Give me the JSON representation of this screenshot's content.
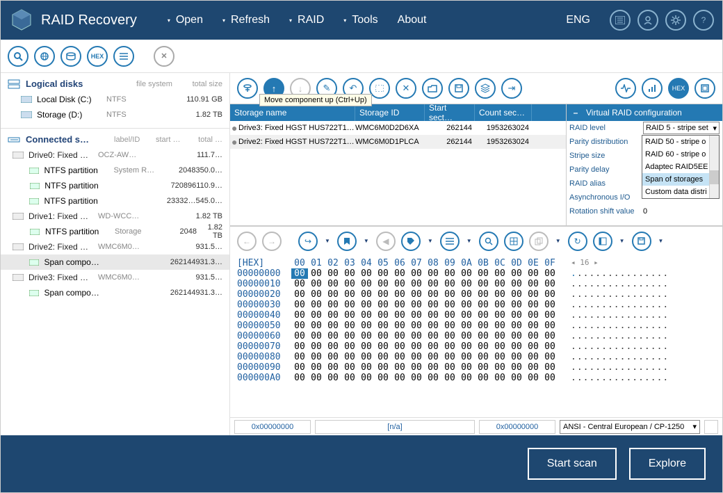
{
  "app": {
    "title": "RAID Recovery"
  },
  "menu": {
    "open": "Open",
    "refresh": "Refresh",
    "raid": "RAID",
    "tools": "Tools",
    "about": "About",
    "lang": "ENG"
  },
  "sidebar": {
    "logical_head": "Logical disks",
    "col_fs": "file system",
    "col_total": "total size",
    "logical": [
      {
        "name": "Local Disk (C:)",
        "fs": "NTFS",
        "size": "110.91 GB"
      },
      {
        "name": "Storage (D:)",
        "fs": "NTFS",
        "size": "1.82 TB"
      }
    ],
    "connected_head": "Connected s…",
    "col_label": "label/ID",
    "col_start": "start …",
    "col_total2": "total …",
    "drives": [
      {
        "name": "Drive0: Fixed …",
        "label": "OCZ-AW…",
        "start": "",
        "size": "111.7…",
        "children": [
          {
            "name": "NTFS partition",
            "label": "System R…",
            "start": "2048",
            "size": "350.0…"
          },
          {
            "name": "NTFS partition",
            "label": "",
            "start": "720896",
            "size": "110.9…"
          },
          {
            "name": "NTFS partition",
            "label": "",
            "start": "23332…",
            "size": "545.0…"
          }
        ]
      },
      {
        "name": "Drive1: Fixed …",
        "label": "WD-WCC…",
        "start": "",
        "size": "1.82 TB",
        "children": [
          {
            "name": "NTFS partition",
            "label": "Storage",
            "start": "2048",
            "size": "1.82 TB"
          }
        ]
      },
      {
        "name": "Drive2: Fixed …",
        "label": "WMC6M0…",
        "start": "",
        "size": "931.5…",
        "children": [
          {
            "name": "Span compo…",
            "label": "",
            "start": "262144",
            "size": "931.3…",
            "sel": true
          }
        ]
      },
      {
        "name": "Drive3: Fixed …",
        "label": "WMC6M0…",
        "start": "",
        "size": "931.5…",
        "children": [
          {
            "name": "Span compo…",
            "label": "",
            "start": "262144",
            "size": "931.3…"
          }
        ]
      }
    ]
  },
  "tooltip": "Move component up (Ctrl+Up)",
  "storage_table": {
    "headers": {
      "name": "Storage name",
      "id": "Storage ID",
      "start": "Start sect…",
      "count": "Count sec…"
    },
    "rows": [
      {
        "name": "Drive3: Fixed HGST HUS722T1…",
        "id": "WMC6M0D2D6XA",
        "start": "262144",
        "count": "1953263024"
      },
      {
        "name": "Drive2: Fixed HGST HUS722T1…",
        "id": "WMC6M0D1PLCA",
        "start": "262144",
        "count": "1953263024"
      }
    ]
  },
  "raid": {
    "title": "Virtual RAID configuration",
    "rows": {
      "level_lbl": "RAID level",
      "level_val": "RAID 5 - stripe set",
      "parity_lbl": "Parity distribution",
      "stripe_lbl": "Stripe size",
      "delay_lbl": "Parity delay",
      "alias_lbl": "RAID alias",
      "async_lbl": "Asynchronous I/O",
      "rot_lbl": "Rotation shift value",
      "rot_val": "0"
    },
    "dropdown": [
      "RAID 50 - stripe o",
      "RAID 60 - stripe o",
      "Adaptec RAID5EE",
      "Span of storages",
      "Custom data distri"
    ],
    "dropdown_hi": 3
  },
  "hex": {
    "label": "[HEX]",
    "cols": [
      "00",
      "01",
      "02",
      "03",
      "04",
      "05",
      "06",
      "07",
      "08",
      "09",
      "0A",
      "0B",
      "0C",
      "0D",
      "0E",
      "0F"
    ],
    "width": "16",
    "rows": [
      "00000000",
      "00000010",
      "00000020",
      "00000030",
      "00000040",
      "00000050",
      "00000060",
      "00000070",
      "00000080",
      "00000090",
      "000000A0"
    ],
    "status": {
      "off1": "0x00000000",
      "na": "[n/a]",
      "off2": "0x00000000",
      "enc": "ANSI - Central European / CP-1250"
    }
  },
  "footer": {
    "scan": "Start scan",
    "explore": "Explore"
  }
}
